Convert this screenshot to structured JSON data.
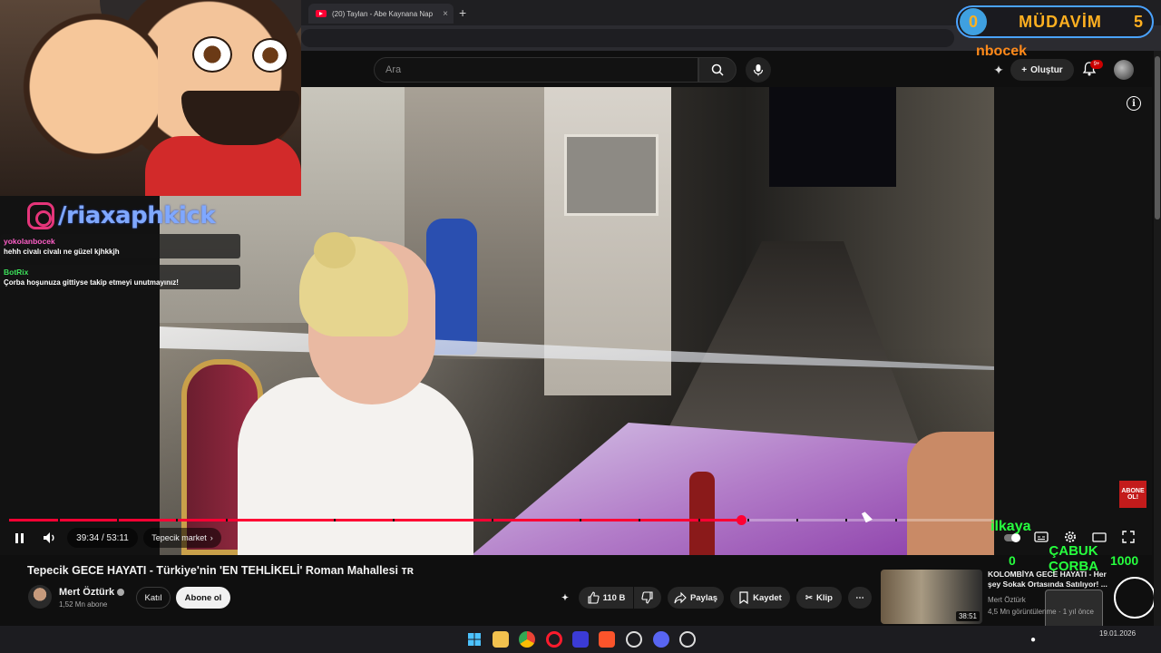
{
  "browser": {
    "tab_title": "(20) Taylan - Abe Kaynana Nap",
    "tab_close": "×",
    "new_tab": "+"
  },
  "yt_header": {
    "search_placeholder": "Ara",
    "create_label": "Oluştur",
    "notifications_badge": "9+"
  },
  "player": {
    "time_display": "39:34 / 53:11",
    "current_time": "39:34",
    "duration": "53:11",
    "progress_fraction": 0.744,
    "chapter_label": "Tepecik market",
    "chapter_chevron": "›",
    "chapter_markers": [
      0.05,
      0.11,
      0.17,
      0.22,
      0.33,
      0.39,
      0.49,
      0.58,
      0.64,
      0.7,
      0.75,
      0.8,
      0.85,
      0.9
    ]
  },
  "video_info": {
    "title": "Tepecik GECE HAYATI - Türkiye'nin 'EN TEHLİKELİ' Roman Mahallesi ᴛʀ",
    "channel_name": "Mert Öztürk",
    "subscribers": "1,52 Mn abone",
    "join_label": "Katıl",
    "subscribe_label": "Abone ol",
    "like_count": "110 B",
    "share_label": "Paylaş",
    "save_label": "Kaydet",
    "clip_label": "Klip",
    "more_label": "⋯"
  },
  "recommendation": {
    "title": "KOLOMBİYA GECE HAYATI - Her şey Sokak Ortasında Satılıyor! ...",
    "channel": "Mert Öztürk",
    "meta": "4,5 Mn görüntülenme · 1 yıl önce",
    "duration": "38:51"
  },
  "overlay": {
    "instagram_handle": "/riaxaphkick",
    "chat": [
      {
        "user": "yokolanbocek",
        "text": "hehh civalı civalı ne güzel kjhkkjh",
        "color": "#ff5fc8"
      },
      {
        "user": "BotRix",
        "text": "Çorba hoşunuza gittiyse takip etmeyi unutmayınız!",
        "color": "#3ce05a"
      }
    ],
    "mudavim_label": "MÜDAVİM",
    "mudavim_left": "0",
    "mudavim_count": "5",
    "top_name": "nbocek",
    "abone_badge_line1": "ABONE",
    "abone_badge_line2": "OL!",
    "likaya": "ilkaya",
    "corba_current": "0",
    "corba_label_line1": "ÇABUK",
    "corba_label_line2": "ÇORBA",
    "corba_goal": "1000"
  },
  "taskbar": {
    "date": "19.01.2026",
    "time": ""
  },
  "colors": {
    "accent_red": "#ff0033",
    "overlay_green": "#26ff3e",
    "overlay_orange": "#ffb020"
  }
}
